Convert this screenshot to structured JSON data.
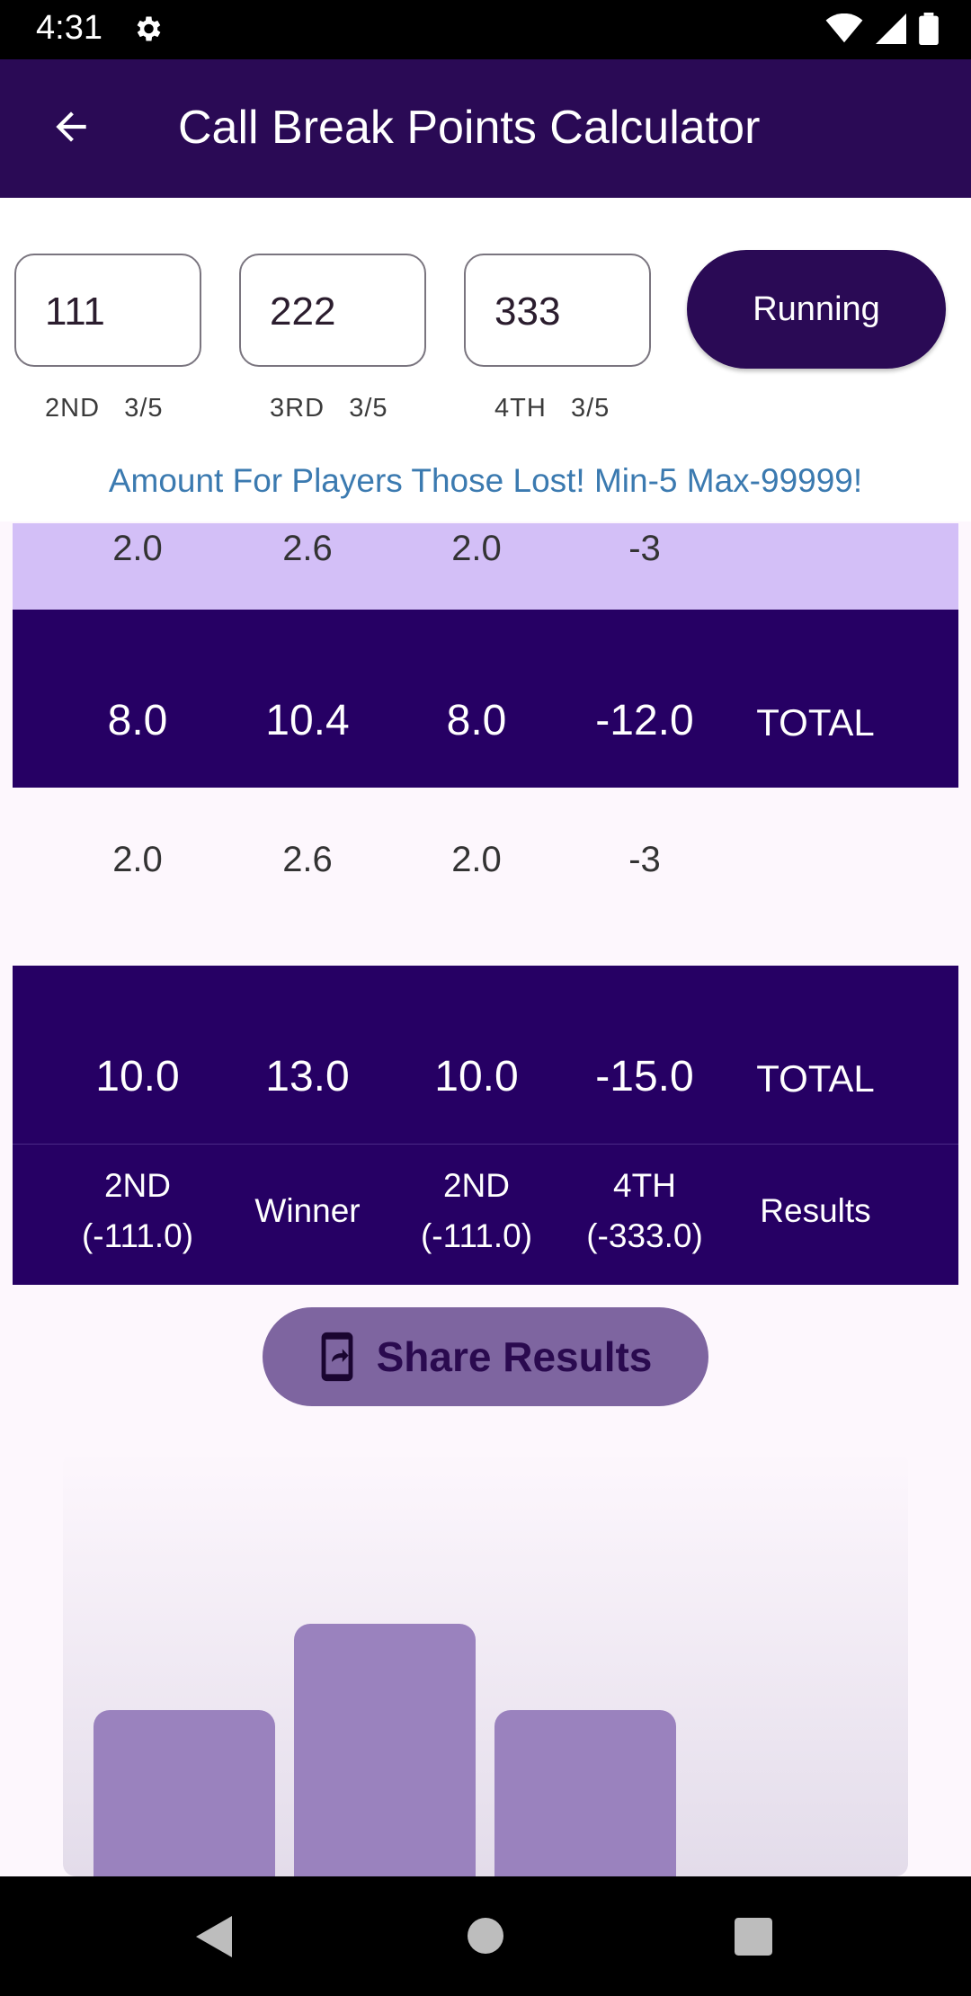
{
  "status_bar": {
    "time": "4:31"
  },
  "app_bar": {
    "title": "Call Break Points Calculator"
  },
  "amounts": [
    {
      "value": "111",
      "position": "2ND",
      "ratio": "3/5"
    },
    {
      "value": "222",
      "position": "3RD",
      "ratio": "3/5"
    },
    {
      "value": "333",
      "position": "4TH",
      "ratio": "3/5"
    }
  ],
  "running_button": "Running",
  "amount_note": "Amount For Players Those Lost! Min-5 Max-99999!",
  "rows": {
    "round_a": [
      "2.0",
      "2.6",
      "2.0",
      "-3"
    ],
    "total_a": [
      "8.0",
      "10.4",
      "8.0",
      "-12.0",
      "TOTAL"
    ],
    "round_b": [
      "2.0",
      "2.6",
      "2.0",
      "-3"
    ],
    "total_b": [
      "10.0",
      "13.0",
      "10.0",
      "-15.0",
      "TOTAL"
    ],
    "results": [
      {
        "line1": "2ND",
        "line2": "(-111.0)"
      },
      {
        "line1": "Winner",
        "line2": ""
      },
      {
        "line1": "2ND",
        "line2": "(-111.0)"
      },
      {
        "line1": "4TH",
        "line2": "(-333.0)"
      },
      {
        "line1": "Results",
        "line2": ""
      }
    ]
  },
  "share_button": "Share Results",
  "chart_data": {
    "type": "bar",
    "categories": [
      "",
      "",
      ""
    ],
    "values": [
      10.0,
      13.0,
      10.0
    ]
  },
  "icons": {
    "back": "arrow-left-icon",
    "settings": "gear-icon",
    "share": "phone-share-icon",
    "nav_back": "triangle-back-icon",
    "nav_home": "circle-home-icon",
    "nav_recents": "square-recents-icon"
  },
  "colors": {
    "primary": "#2a0a55",
    "table_dark": "#260064",
    "table_light": "#d3bff7",
    "note_text": "#3b7ab0",
    "share_bg": "#7e65a0",
    "bar": "#9a82be"
  }
}
